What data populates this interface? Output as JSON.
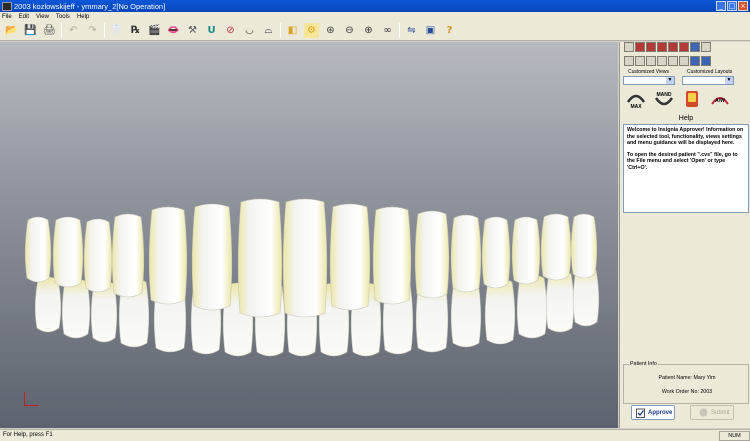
{
  "window": {
    "title": "2003 kozlowskijeff - ymmary_2[No Operation]",
    "minimize_glyph": "_",
    "maximize_glyph": "□",
    "close_glyph": "×"
  },
  "menu": [
    "File",
    "Edit",
    "View",
    "Tools",
    "Help"
  ],
  "toolbar": {
    "glyphs": {
      "open": "📂",
      "save": "💾",
      "print": "🖨",
      "undo": "↶",
      "redo": "↷",
      "chart": "🦷",
      "rx": "℞",
      "clapboard": "🎬",
      "lips": "👄",
      "wand": "⚒",
      "arch": "U",
      "dial": "⊘",
      "smile": "◡",
      "mandible": "⌓",
      "cube": "◧",
      "gear": "⚙",
      "bracket": "⊛",
      "wire": "⊖",
      "jaw": "⊕",
      "occlusion": "∞",
      "toggle": "⇋",
      "monitor": "▣",
      "help": "?"
    },
    "help_label": "?"
  },
  "panel": {
    "customized_views_label": "Customized Views",
    "customized_layouts_label": "Customized Layouts",
    "customized_views_value": "",
    "customized_layouts_value": "",
    "big_icons": {
      "max": "MAX",
      "mand": "MAND",
      "aw": "A/W"
    },
    "help_heading": "Help",
    "help_paragraph_1": "Welcome to Insignia Approver! Information on the selected tool, functionality, views settings and menu guidance will be displayed here.",
    "help_paragraph_2": "To open the desired patient \".cvs\" file, go to the File menu and select 'Open' or type 'Ctrl+O'.",
    "patient_info_label": "Patient Info",
    "patient_name": "Patient Name: Mary Yim",
    "work_order": "Work Order No: 2003",
    "approve_label": "Approve",
    "submit_label": "Submit"
  },
  "status": {
    "text": "For Help, press F1",
    "num": "NUM"
  },
  "colors": {
    "titlebar": "#0b57d8",
    "viewport_top": "#b6bac0",
    "viewport_bottom": "#5d636e",
    "tooth": "#f3f3ef",
    "gum_tint": "#ece6a6"
  }
}
